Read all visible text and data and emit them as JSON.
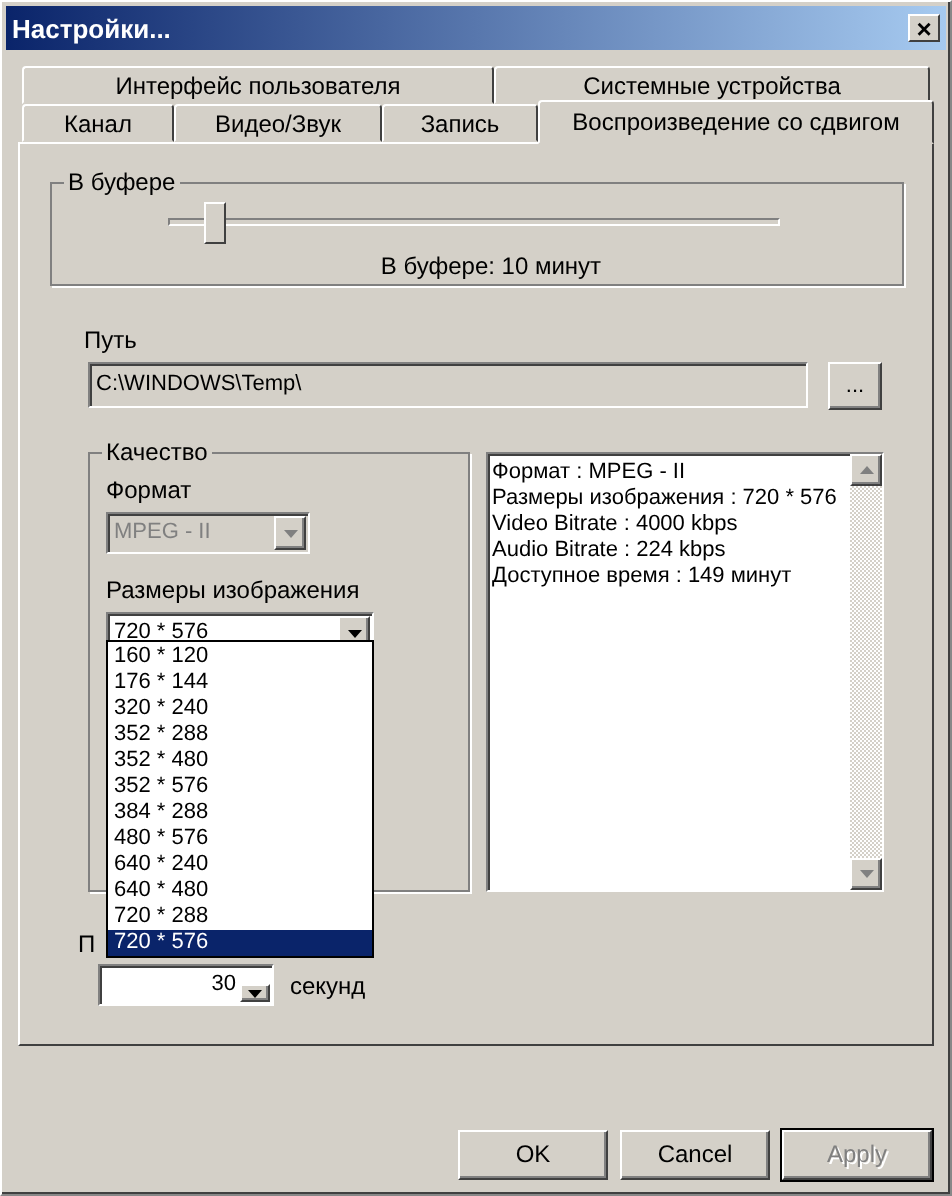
{
  "window": {
    "title": "Настройки...",
    "close": "×"
  },
  "tab_rows": [
    {
      "tabs": [
        {
          "label": "Интерфейс пользователя",
          "selected": false
        },
        {
          "label": "Системные устройства",
          "selected": false
        }
      ]
    },
    {
      "tabs": [
        {
          "label": "Канал",
          "selected": false
        },
        {
          "label": "Видео/Звук",
          "selected": false
        },
        {
          "label": "Запись",
          "selected": false
        },
        {
          "label": "Воспроизведение со сдвигом",
          "selected": true
        }
      ]
    }
  ],
  "buffer": {
    "title": "В буфере",
    "level": 0.075,
    "reading": "В буфере: 10 минут"
  },
  "path": {
    "label": "Путь",
    "value": "C:\\WINDOWS\\Temp\\",
    "browse": "..."
  },
  "quality": {
    "title": "Качество",
    "format_label": "Формат",
    "format": {
      "value": "MPEG - II",
      "disabled": true
    },
    "size_label": "Размеры изображения",
    "size": {
      "value": "720 * 576",
      "expanded": true
    },
    "options": [
      {
        "label": "160 * 120",
        "selected": false
      },
      {
        "label": "176 * 144",
        "selected": false
      },
      {
        "label": "320 * 240",
        "selected": false
      },
      {
        "label": "352 * 288",
        "selected": false
      },
      {
        "label": "352 * 480",
        "selected": false
      },
      {
        "label": "352 * 576",
        "selected": false
      },
      {
        "label": "384 * 288",
        "selected": false
      },
      {
        "label": "480 * 576",
        "selected": false
      },
      {
        "label": "640 * 240",
        "selected": false
      },
      {
        "label": "640 * 480",
        "selected": false
      },
      {
        "label": "720 * 288",
        "selected": false
      },
      {
        "label": "720 * 576",
        "selected": true
      }
    ]
  },
  "info": [
    "Формат : MPEG - II",
    "Размеры изображения : 720 * 576",
    "Video Bitrate : 4000 kbps",
    "Audio Bitrate : 224 kbps",
    "Доступное время : 149 минут"
  ],
  "delay": {
    "label": "П",
    "value": "30",
    "unit": "секунд"
  },
  "buttons": [
    {
      "label": "OK",
      "disabled": false
    },
    {
      "label": "Cancel",
      "disabled": false
    },
    {
      "label": "Apply",
      "disabled": true
    }
  ]
}
